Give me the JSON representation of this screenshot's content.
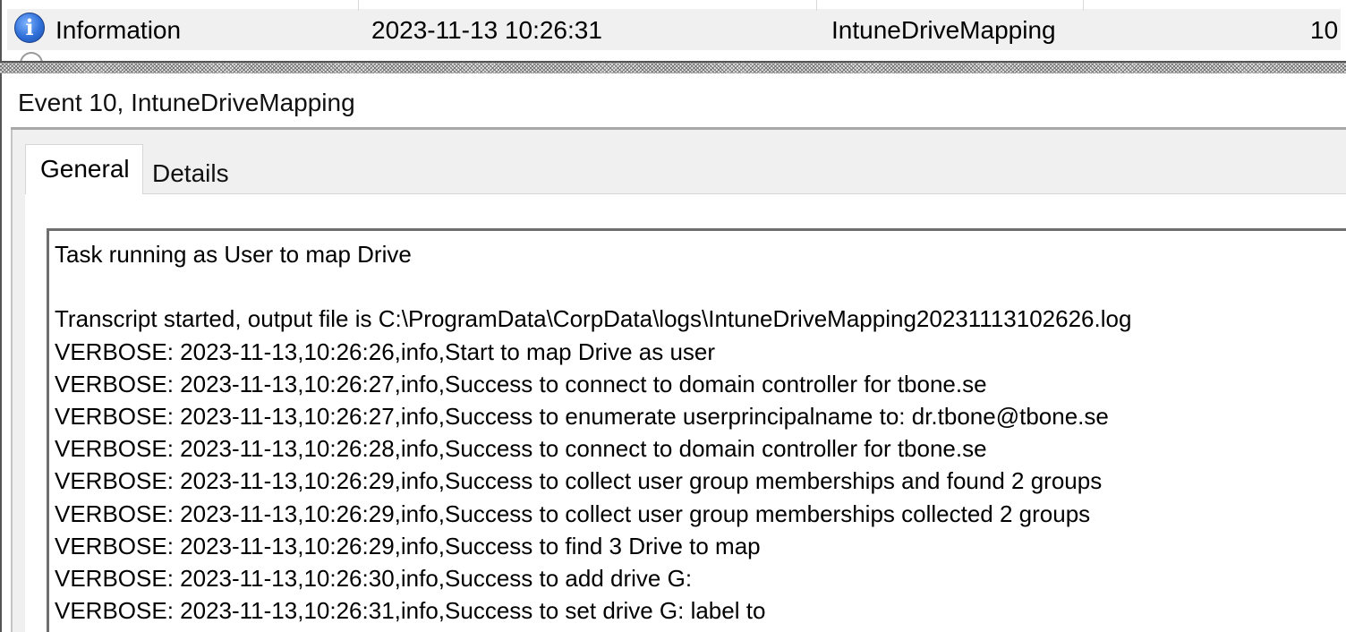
{
  "event_row": {
    "level": "Information",
    "date_time": "2023-11-13 10:26:31",
    "source": "IntuneDriveMapping",
    "event_id": "10"
  },
  "details_pane": {
    "title": "Event 10, IntuneDriveMapping",
    "tabs": [
      "General",
      "Details"
    ],
    "selected_tab": "General",
    "description_lines": [
      "Task running as User to map Drive",
      "",
      "Transcript started, output file is C:\\ProgramData\\CorpData\\logs\\IntuneDriveMapping20231113102626.log",
      "VERBOSE: 2023-11-13,10:26:26,info,Start to map Drive as user",
      "VERBOSE: 2023-11-13,10:26:27,info,Success to connect to domain controller for tbone.se",
      "VERBOSE: 2023-11-13,10:26:27,info,Success to enumerate userprincipalname to: dr.tbone@tbone.se",
      "VERBOSE: 2023-11-13,10:26:28,info,Success to connect to domain controller for tbone.se",
      "VERBOSE: 2023-11-13,10:26:29,info,Success to collect user group memberships and found 2 groups",
      "VERBOSE: 2023-11-13,10:26:29,info,Success to collect user group memberships collected 2 groups",
      "VERBOSE: 2023-11-13,10:26:29,info,Success to find 3 Drive to map",
      "VERBOSE: 2023-11-13,10:26:30,info,Success to add drive G:",
      "VERBOSE: 2023-11-13,10:26:31,info,Success to set drive G: label to"
    ]
  },
  "icons": {
    "level_icon": "information-icon",
    "next_row_icon": "information-icon"
  },
  "colors": {
    "selection_bg": "#f0f0f0",
    "info_icon_blue": "#2f6fd8",
    "frame_border": "#6e6e6e"
  }
}
